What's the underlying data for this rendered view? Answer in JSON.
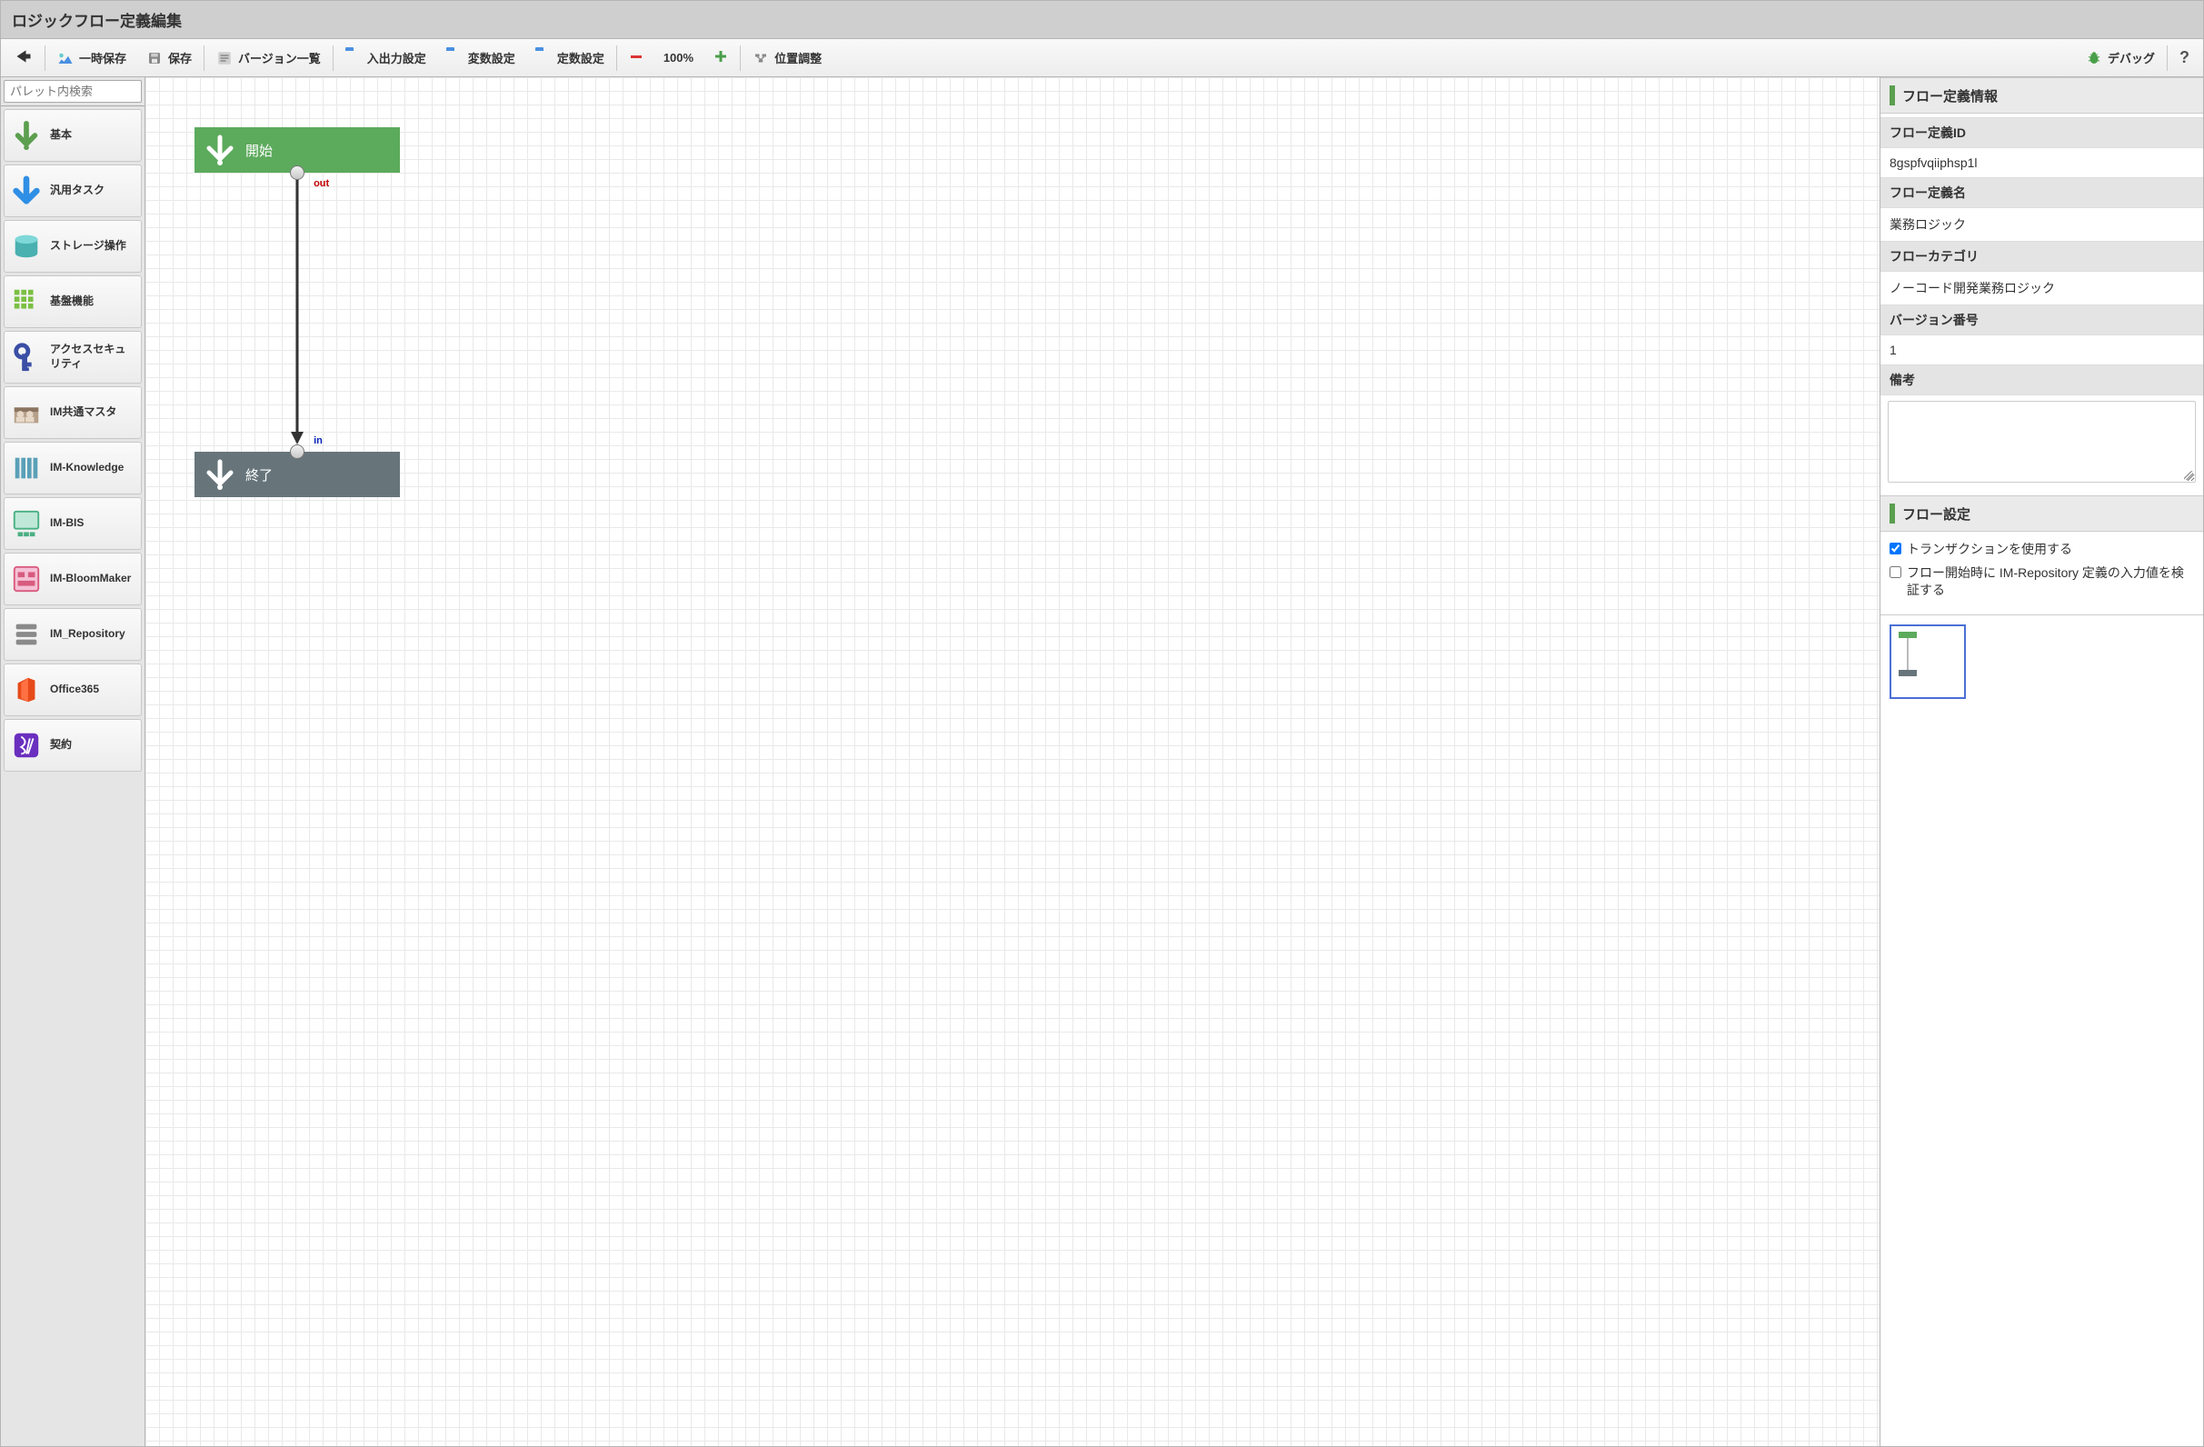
{
  "title": "ロジックフロー定義編集",
  "toolbar": {
    "tempSave": "一時保存",
    "save": "保存",
    "versionList": "バージョン一覧",
    "ioSettings": "入出力設定",
    "varSettings": "変数設定",
    "constSettings": "定数設定",
    "zoom": "100%",
    "reposition": "位置調整",
    "debug": "デバッグ"
  },
  "palette": {
    "searchPlaceholder": "パレット内検索",
    "items": [
      {
        "id": "basic",
        "label": "基本",
        "iconColor": "#5b9f4f"
      },
      {
        "id": "generic-task",
        "label": "汎用タスク",
        "iconColor": "#2f8fe5"
      },
      {
        "id": "storage",
        "label": "ストレージ操作",
        "iconColor": "#5fc9c9"
      },
      {
        "id": "infra",
        "label": "基盤機能",
        "iconColor": "#7bc043"
      },
      {
        "id": "access-security",
        "label": "アクセスセキュリティ",
        "iconColor": "#3a4fa5"
      },
      {
        "id": "im-common-master",
        "label": "IM共通マスタ",
        "iconColor": "#7a6a5a"
      },
      {
        "id": "im-knowledge",
        "label": "IM-Knowledge",
        "iconColor": "#5aa0b8"
      },
      {
        "id": "im-bis",
        "label": "IM-BIS",
        "iconColor": "#4ab083"
      },
      {
        "id": "im-bloommaker",
        "label": "IM-BloomMaker",
        "iconColor": "#d85b7f"
      },
      {
        "id": "im-repository",
        "label": "IM_Repository",
        "iconColor": "#7a7a7a"
      },
      {
        "id": "office365",
        "label": "Office365",
        "iconColor": "#e64a19"
      },
      {
        "id": "contract",
        "label": "契約",
        "iconColor": "#6a2fbf"
      }
    ]
  },
  "canvas": {
    "startLabel": "開始",
    "endLabel": "終了",
    "outLabel": "out",
    "inLabel": "in"
  },
  "rightPanel": {
    "infoHeader": "フロー定義情報",
    "flowIdLabel": "フロー定義ID",
    "flowIdValue": "8gspfvqiiphsp1l",
    "flowNameLabel": "フロー定義名",
    "flowNameValue": "業務ロジック",
    "flowCategoryLabel": "フローカテゴリ",
    "flowCategoryValue": "ノーコード開発業務ロジック",
    "versionLabel": "バージョン番号",
    "versionValue": "1",
    "notesLabel": "備考",
    "settingsHeader": "フロー設定",
    "transactionLabel": "トランザクションを使用する",
    "validateLabel": "フロー開始時に IM-Repository 定義の入力値を検証する"
  }
}
